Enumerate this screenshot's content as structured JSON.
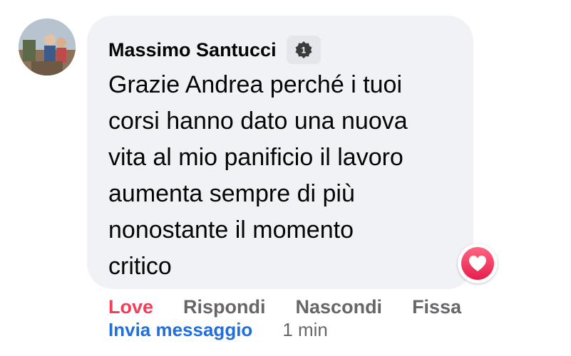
{
  "comment": {
    "author": "Massimo Santucci",
    "text": "Grazie Andrea perché i tuoi\ncorsi hanno dato una nuova\nvita al mio panificio il lavoro\naumenta sempre di più\nnonostante il momento\ncritico",
    "badge_icon": "top-fan-badge-icon",
    "reaction_icon": "love-reaction-icon"
  },
  "actions": {
    "love": "Love",
    "reply": "Rispondi",
    "hide": "Nascondi",
    "pin": "Fissa",
    "send_message": "Invia messaggio",
    "time": "1 min"
  },
  "colors": {
    "bubble_bg": "#f0f2f5",
    "love": "#f33e58",
    "link": "#216fdb",
    "muted": "#65676b",
    "text": "#050505"
  }
}
